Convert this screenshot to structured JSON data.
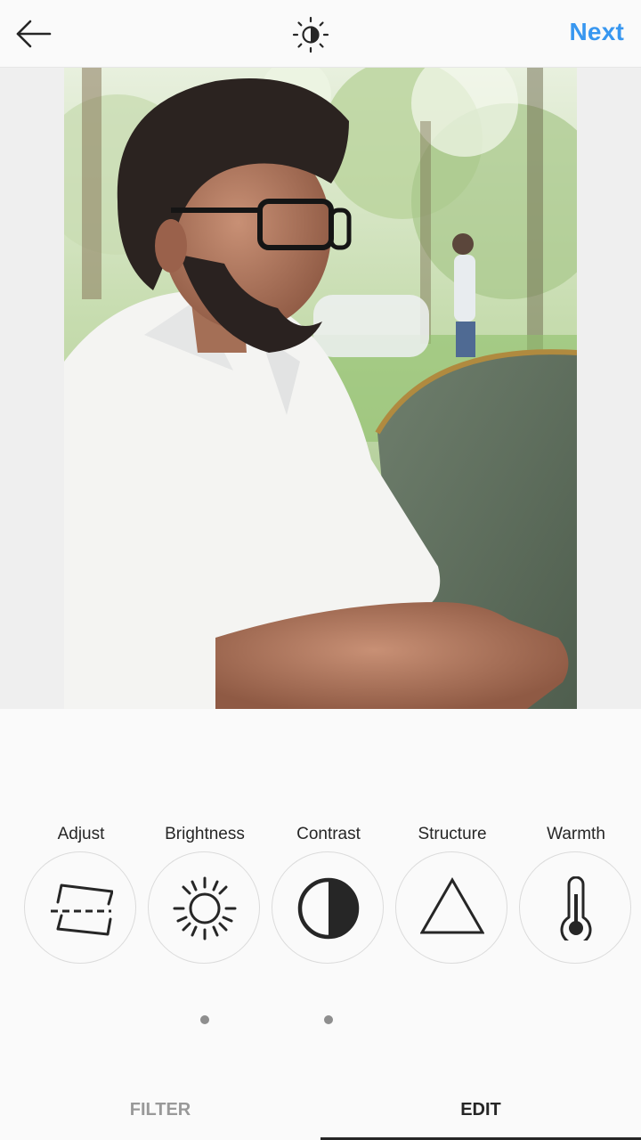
{
  "header": {
    "back_icon": "arrow-left-icon",
    "lux_icon": "lux-sun-icon",
    "next_label": "Next",
    "accent_color": "#3897f0"
  },
  "photo": {
    "subject": "Portrait photo of a man with glasses and beard in white shirt, seated outdoors"
  },
  "tools": [
    {
      "label": "Adjust",
      "icon": "adjust-icon"
    },
    {
      "label": "Brightness",
      "icon": "brightness-sun-icon"
    },
    {
      "label": "Contrast",
      "icon": "contrast-half-circle-icon"
    },
    {
      "label": "Structure",
      "icon": "structure-triangle-icon"
    },
    {
      "label": "Warmth",
      "icon": "thermometer-icon"
    }
  ],
  "tabs": [
    {
      "label": "FILTER",
      "active": false
    },
    {
      "label": "EDIT",
      "active": true
    }
  ]
}
